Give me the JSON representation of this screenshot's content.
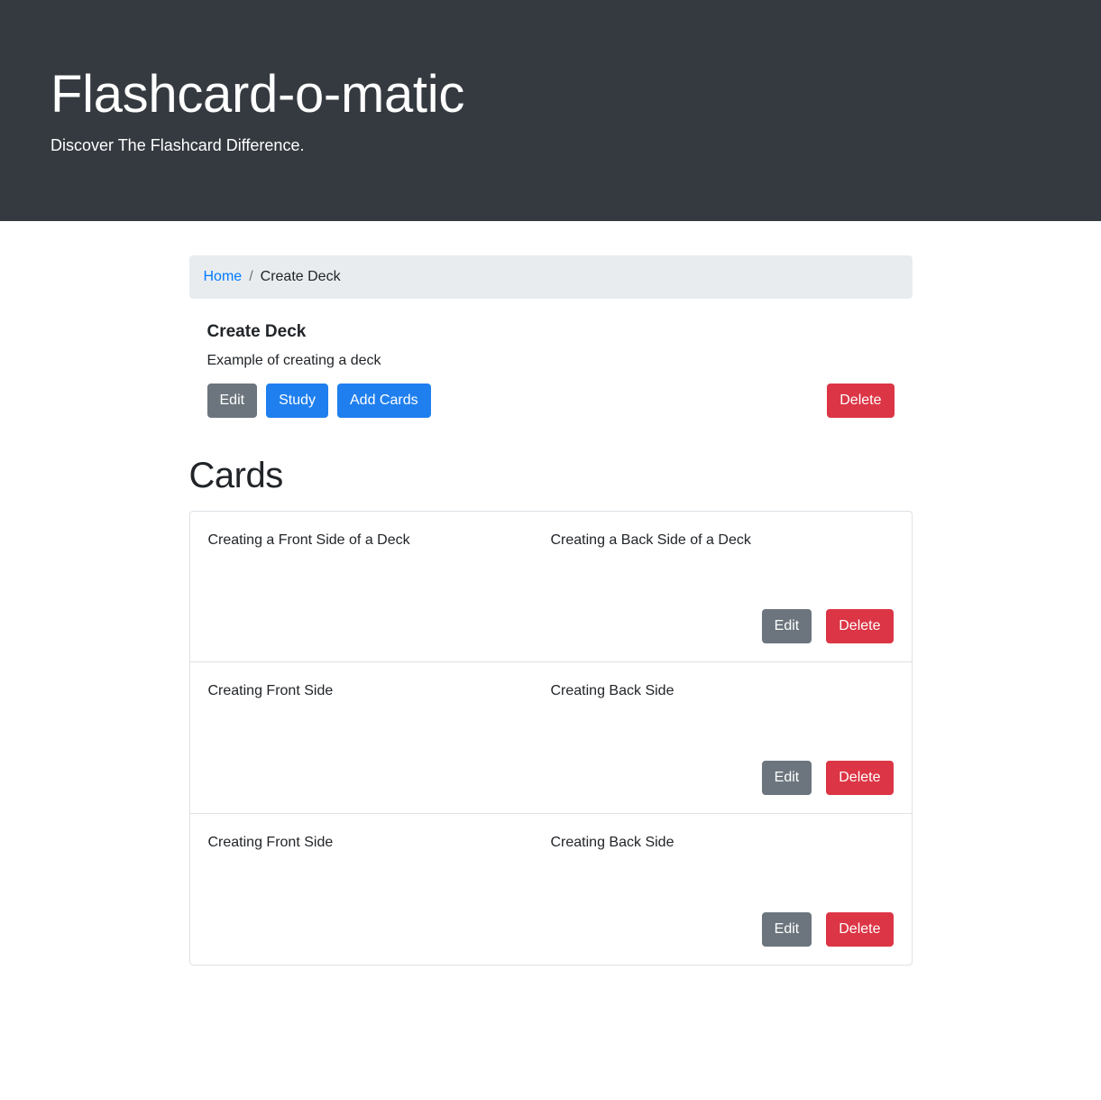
{
  "header": {
    "title": "Flashcard-o-matic",
    "subtitle": "Discover The Flashcard Difference."
  },
  "breadcrumb": {
    "home_label": "Home",
    "separator": "/",
    "current_label": "Create Deck"
  },
  "deck": {
    "name": "Create Deck",
    "description": "Example of creating a deck",
    "edit_label": "Edit",
    "study_label": "Study",
    "add_cards_label": "Add Cards",
    "delete_label": "Delete"
  },
  "cards_section": {
    "heading": "Cards",
    "edit_label": "Edit",
    "delete_label": "Delete",
    "items": [
      {
        "front": "Creating a Front Side of a Deck",
        "back": "Creating a Back Side of a Deck"
      },
      {
        "front": "Creating Front Side",
        "back": "Creating Back Side"
      },
      {
        "front": "Creating Front Side",
        "back": "Creating Back Side"
      }
    ]
  },
  "colors": {
    "header_background": "#343a40",
    "breadcrumb_background": "#e9ecef",
    "link": "#007bff",
    "primary": "#1f7fef",
    "secondary": "#6c757d",
    "danger": "#dc3545",
    "card_border": "#dee2e6",
    "text": "#212529"
  }
}
